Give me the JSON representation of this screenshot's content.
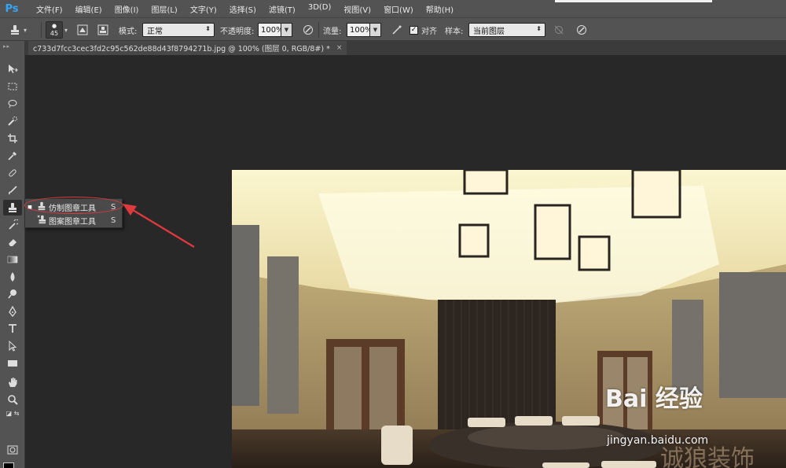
{
  "app": {
    "logo": "Ps"
  },
  "menu": [
    "文件(F)",
    "编辑(E)",
    "图像(I)",
    "图层(L)",
    "文字(Y)",
    "选择(S)",
    "滤镜(T)",
    "3D(D)",
    "视图(V)",
    "窗口(W)",
    "帮助(H)"
  ],
  "options": {
    "brush_size": "45",
    "mode_label": "模式:",
    "mode_value": "正常",
    "opacity_label": "不透明度:",
    "opacity_value": "100%",
    "flow_label": "流量:",
    "flow_value": "100%",
    "align_label": "对齐",
    "align_checked": true,
    "sample_label": "样本:",
    "sample_value": "当前图层"
  },
  "document": {
    "tab_title": "c733d7fcc3cec3fd2c95c562de88d43f8794271b.jpg @ 100% (图层 0, RGB/8#) *",
    "close": "×"
  },
  "flyout": {
    "items": [
      {
        "label": "仿制图章工具",
        "shortcut": "S",
        "selected": true,
        "icon": "clone-stamp-icon"
      },
      {
        "label": "图案图章工具",
        "shortcut": "S",
        "selected": false,
        "icon": "pattern-stamp-icon"
      }
    ]
  },
  "colors": {
    "ui_panel": "#535353",
    "ui_bg": "#282828",
    "annotation": "#e0393e",
    "foreground": "#000000",
    "background": "#ffffff"
  },
  "watermark": {
    "baidu": "Bai  经验",
    "url": "jingyan.baidu.com",
    "brand": "诚狼装饰"
  }
}
